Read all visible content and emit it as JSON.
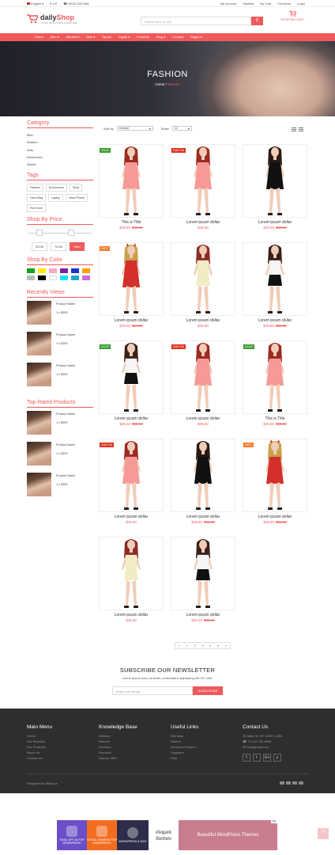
{
  "topbar": {
    "language": "English",
    "currency": "$ US",
    "phone": "08-02-333-658",
    "links": [
      "My Account",
      "Wishlist",
      "My Cart",
      "Checkout",
      "Login"
    ]
  },
  "header": {
    "logo_part1": "daily",
    "logo_part2": "Shop",
    "tagline": "YOUR SHOPPING PARTNER",
    "search_placeholder": "Search here to eqn",
    "cart_label": "SHOPPING CART"
  },
  "nav": [
    "Home",
    "Men",
    "Women",
    "Kids",
    "Sports",
    "Digital",
    "Furniture",
    "Blog",
    "Contact",
    "Pages"
  ],
  "hero": {
    "title": "FASHION",
    "crumb_home": "Home",
    "crumb_sep": "/",
    "crumb_current": "Women"
  },
  "sidebar": {
    "category_title": "Category",
    "categories": [
      "Men",
      "Women",
      "Kids",
      "Electronics",
      "Sports"
    ],
    "tags_title": "Tags",
    "tags": [
      "Fashion",
      "Ecommerce",
      "Shop",
      "Hand Bag",
      "Laptop",
      "Head Phone",
      "Pen Drive"
    ],
    "price_title": "Shop By Price",
    "price_min": "20.00",
    "price_max": "70.00",
    "filter_label": "Filter",
    "color_title": "Shop By Color",
    "colors": [
      "#12a31b",
      "#ffeb00",
      "#f6a9c7",
      "#7e1fa0",
      "#1a33c8",
      "#f6a300",
      "#bdbdbd",
      "#000000",
      "#ffffff",
      "#12e3ff",
      "#1fa7c9",
      "#d46ad9"
    ],
    "recent_title": "Recently Views",
    "recent": [
      {
        "name": "Product Name",
        "price": "1 x $250"
      },
      {
        "name": "Product Name",
        "price": "1 x $250"
      },
      {
        "name": "Product Name",
        "price": "1 x $250"
      }
    ],
    "top_title": "Top Rated Products",
    "top": [
      {
        "name": "Product Name",
        "price": "1 x $250"
      },
      {
        "name": "Product Name",
        "price": "1 x $250"
      },
      {
        "name": "Product Name",
        "price": "1 x $250"
      }
    ]
  },
  "sorting": {
    "sort_label": "Sort by",
    "sort_value": "Default",
    "show_label": "Show",
    "show_value": "12"
  },
  "products": [
    {
      "name": "This is Title",
      "price": "$45.50",
      "old": "$65.50",
      "badge": "SALE!",
      "badge_type": "sale",
      "look": "pink-dress"
    },
    {
      "name": "Lorem ipsum dollar",
      "price": "$45.50",
      "old": "",
      "badge": "Sold Out",
      "badge_type": "sold",
      "look": "pink-dress"
    },
    {
      "name": "Lorem ipsum dollar",
      "price": "$45.50",
      "old": "$65.50",
      "badge": "",
      "badge_type": "",
      "look": "black-dress"
    },
    {
      "name": "Lorem ipsum dollar",
      "price": "$45.50",
      "old": "$65.50",
      "badge": "HOT!",
      "badge_type": "hot",
      "look": "red-devil"
    },
    {
      "name": "Lorem ipsum dollar",
      "price": "$45.50",
      "old": "",
      "badge": "",
      "badge_type": "",
      "look": "cream-top"
    },
    {
      "name": "Lorem ipsum dollar",
      "price": "$45.50",
      "old": "$65.50",
      "badge": "",
      "badge_type": "",
      "look": "white-black"
    },
    {
      "name": "Lorem ipsum dollar",
      "price": "$45.50",
      "old": "$65.50",
      "badge": "SALE!",
      "badge_type": "sale",
      "look": "white-black"
    },
    {
      "name": "Lorem ipsum dollar",
      "price": "$45.50",
      "old": "",
      "badge": "Sold Out",
      "badge_type": "sold",
      "look": "pink-dress"
    },
    {
      "name": "This is Title",
      "price": "$45.50",
      "old": "$65.50",
      "badge": "SALE!",
      "badge_type": "sale",
      "look": "pink-dress"
    },
    {
      "name": "Lorem ipsum dollar",
      "price": "$45.50",
      "old": "",
      "badge": "Sold Out",
      "badge_type": "sold",
      "look": "pink-dress"
    },
    {
      "name": "Lorem ipsum dollar",
      "price": "$45.50",
      "old": "$65.50",
      "badge": "",
      "badge_type": "",
      "look": "black-dress"
    },
    {
      "name": "Lorem ipsum dollar",
      "price": "$45.50",
      "old": "$65.50",
      "badge": "HOT!",
      "badge_type": "hot",
      "look": "red-devil"
    },
    {
      "name": "Lorem ipsum dollar",
      "price": "$45.50",
      "old": "",
      "badge": "",
      "badge_type": "",
      "look": "cream-top"
    },
    {
      "name": "Lorem ipsum dollar",
      "price": "$45.50",
      "old": "$65.50",
      "badge": "",
      "badge_type": "",
      "look": "white-black"
    }
  ],
  "pagination": [
    "«",
    "1",
    "2",
    "3",
    "4",
    "5",
    "»"
  ],
  "newsletter": {
    "title": "SUBSCRIBE OUR NEWSLETTER",
    "text": "Lorem ipsum dolor sit amet, consectetur adipisicing elit. Ex, velit.",
    "placeholder": "Enter your Email",
    "button": "SUBSCRIBE"
  },
  "footer": {
    "cols": [
      {
        "title": "Main Menu",
        "items": [
          "Home",
          "Our Services",
          "Our Products",
          "About Us",
          "Contact Us"
        ]
      },
      {
        "title": "Knowledge Base",
        "items": [
          "Delivery",
          "Returns",
          "Services",
          "Discount",
          "Special Offer"
        ]
      },
      {
        "title": "Useful Links",
        "items": [
          "Site Map",
          "Search",
          "Advanced Search",
          "Suppliers",
          "FAQ"
        ]
      },
      {
        "title": "Contact Us",
        "items": [
          "25 Aster St, NY 10002, USA",
          "+1 212 782 4589",
          "info@gmail.com"
        ]
      }
    ],
    "socials": [
      "f",
      "t",
      "G+",
      "y"
    ],
    "credit": "Designed by WebUps"
  },
  "ad": {
    "blocks": [
      "EMAIL OPT-IN FOR WORDPRESS",
      "SOCIAL SHARING FOR WORDPRESS",
      "WORDPRESS & EDIT",
      "elegant themes",
      "Beautiful WordPress Themes"
    ],
    "close": "Ad"
  },
  "to_top": "^"
}
